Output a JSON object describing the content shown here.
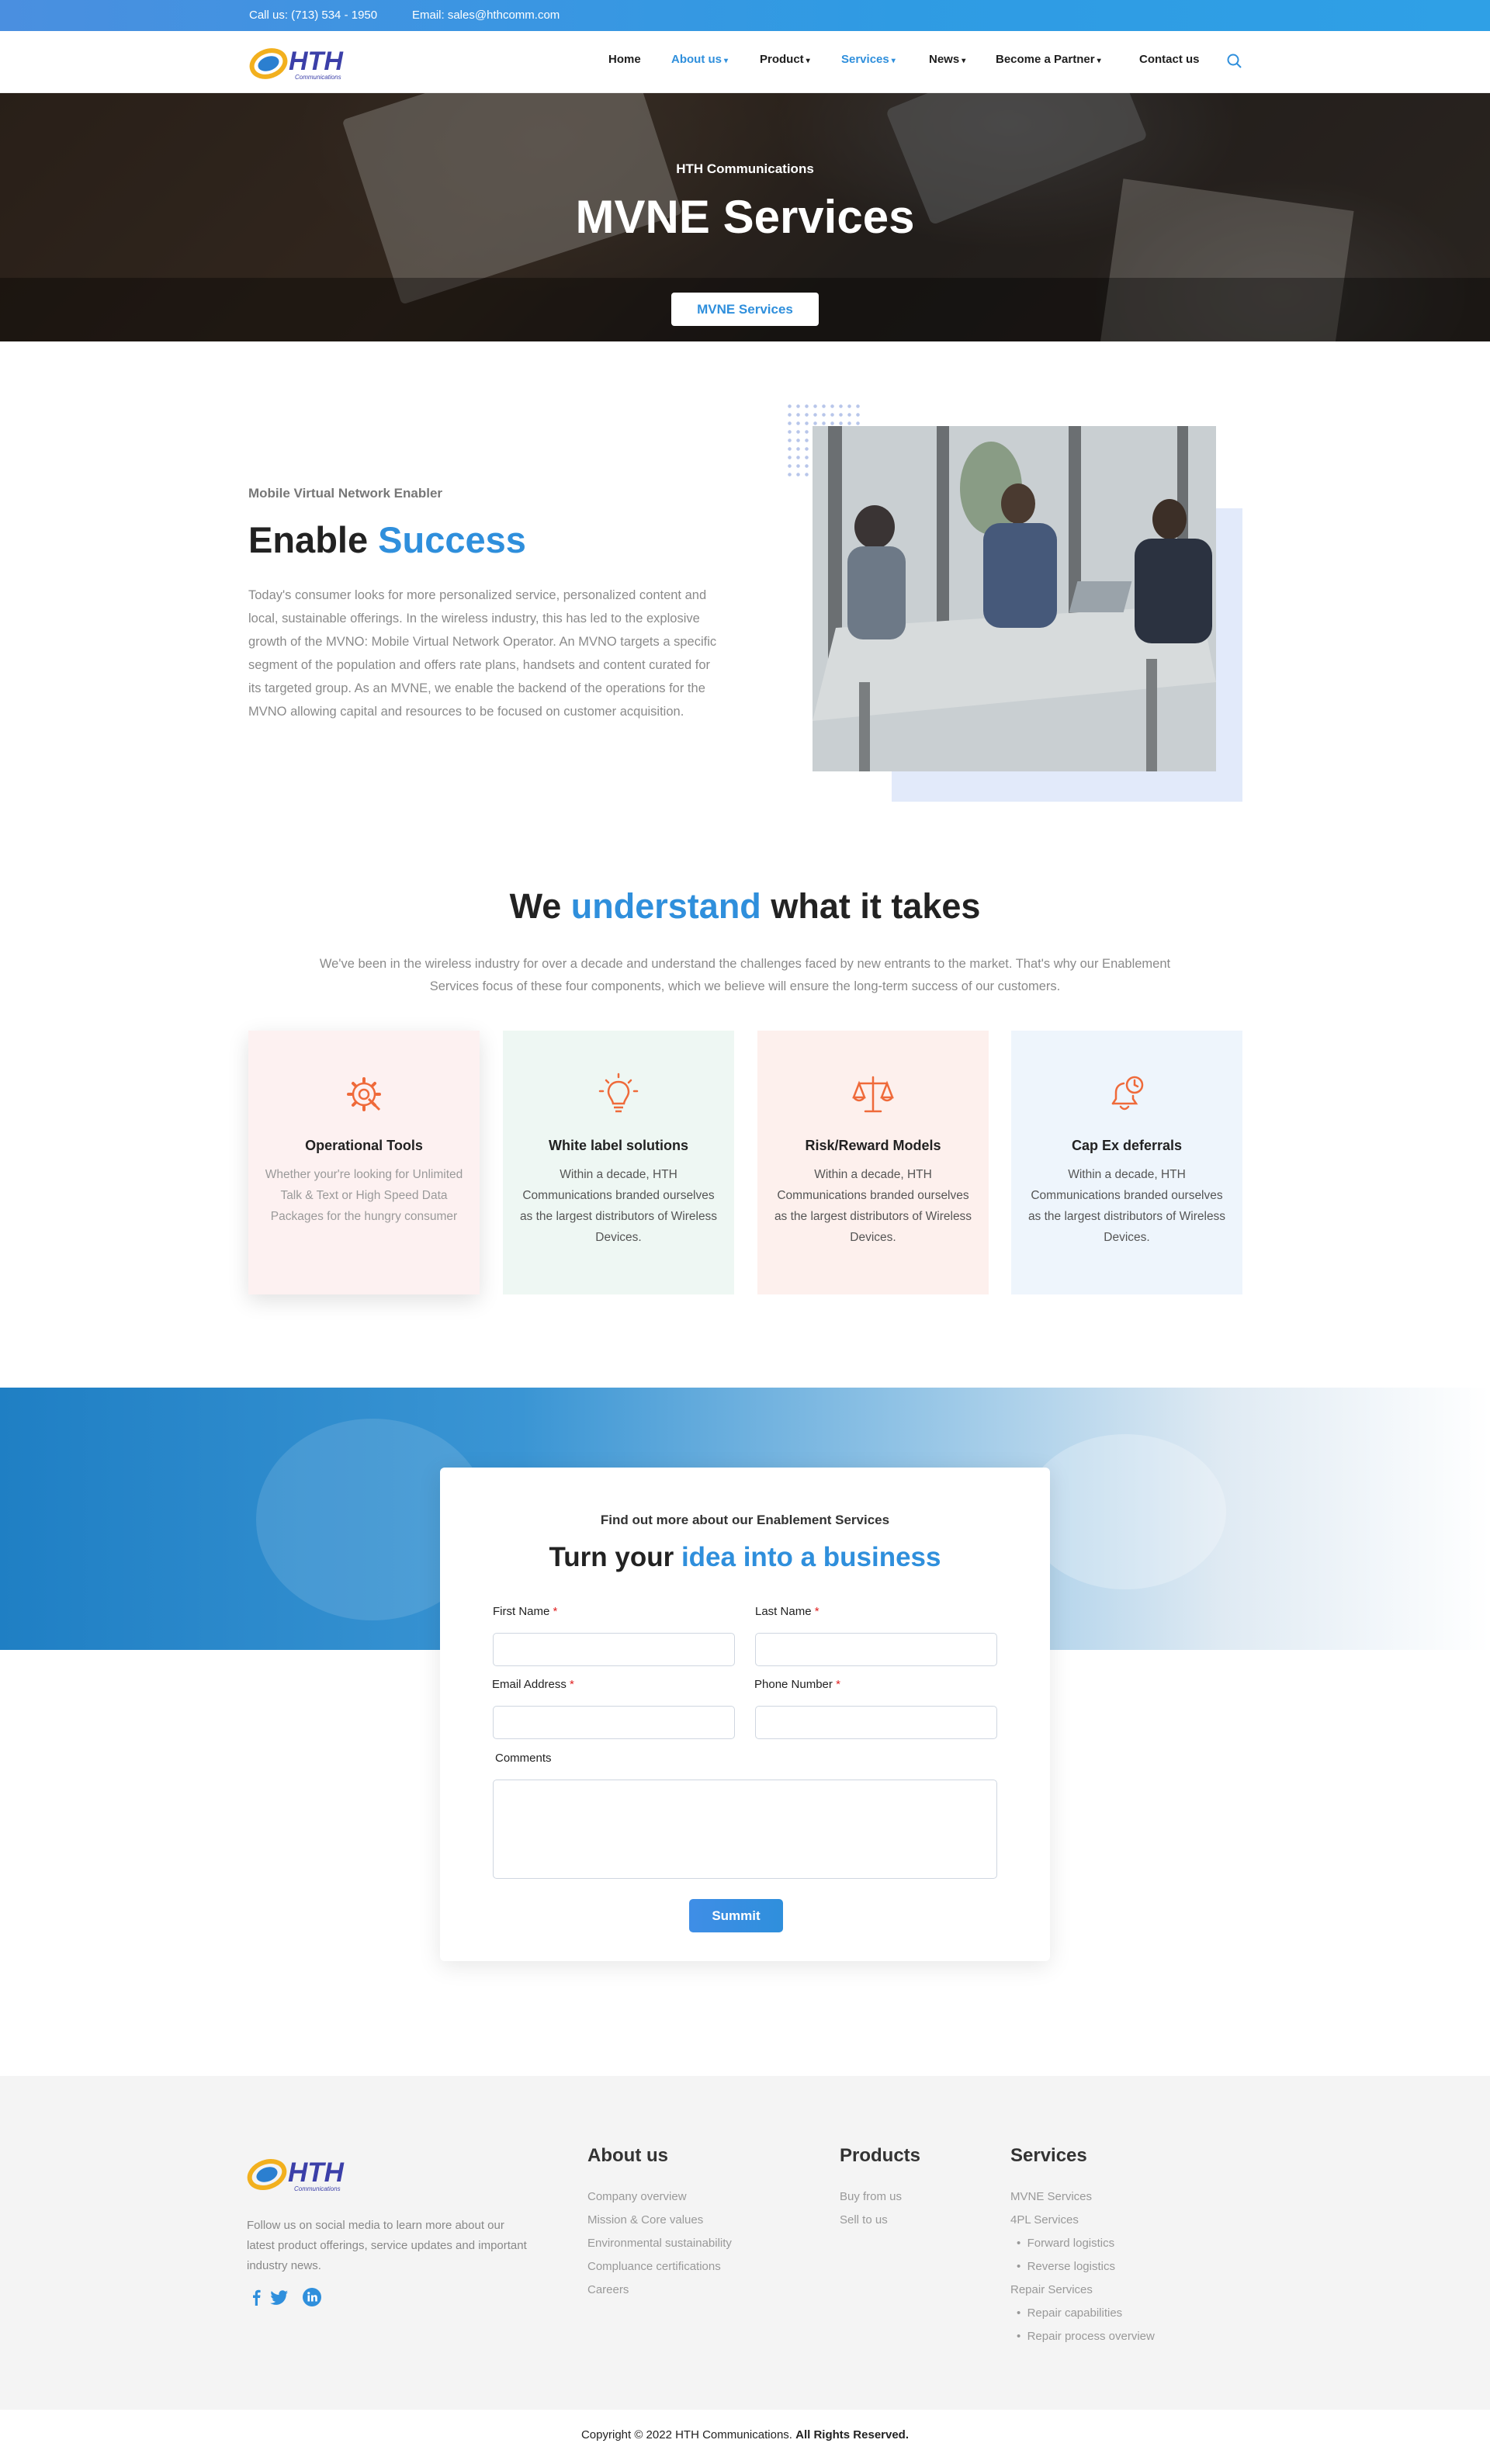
{
  "topbar": {
    "phone": "Call us: (713) 534 - 1950",
    "email": "Email: sales@hthcomm.com"
  },
  "brand": {
    "name": "HTH",
    "tagline": "Communications",
    "accent": "#2f8fdc"
  },
  "nav": {
    "items": [
      {
        "label": "Home"
      },
      {
        "label": "About us"
      },
      {
        "label": "Product"
      },
      {
        "label": "Services"
      },
      {
        "label": "News"
      },
      {
        "label": "Become a Partner"
      },
      {
        "label": "Contact us"
      }
    ],
    "caret": "▾"
  },
  "hero": {
    "subtitle": "HTH Communications",
    "title": "MVNE Services",
    "button": "MVNE Services"
  },
  "intro": {
    "eyebrow": "Mobile Virtual Network Enabler",
    "title_plain": "Enable",
    "title_accent": "Success",
    "body": "Today's consumer looks for more personalized service, personalized content and local, sustainable offerings. In the wireless industry, this has led to the explosive growth of the MVNO: Mobile Virtual Network Operator. An MVNO targets a specific segment of the population and offers rate plans, handsets and content curated for its targeted group. As an MVNE, we enable the backend of the operations for the MVNO allowing capital and resources to be focused on customer acquisition."
  },
  "understand": {
    "title_start": "We",
    "title_accent": "understand",
    "title_end": "what it takes",
    "body": "We've been in the wireless industry for over a decade and understand the challenges faced by new entrants to the market. That's why our Enablement Services focus of these four components, which we believe will ensure the long-term success of our customers.",
    "cards": [
      {
        "title": "Operational Tools",
        "text": "Whether your're looking for Unlimited Talk & Text or High Speed Data Packages for the hungry consumer",
        "icon": "gear-wrench-icon",
        "bg": "#fdf1f1"
      },
      {
        "title": "White label solutions",
        "text": "Within a decade, HTH Communications branded ourselves as the largest distributors of Wireless Devices.",
        "icon": "lightbulb-icon",
        "bg": "#eef7f3"
      },
      {
        "title": "Risk/Reward Models",
        "text": "Within a decade, HTH Communications branded ourselves as the largest distributors of Wireless Devices.",
        "icon": "balance-scale-icon",
        "bg": "#fdf0ed"
      },
      {
        "title": "Cap Ex deferrals",
        "text": "Within a decade, HTH Communications branded ourselves as the largest distributors of Wireless Devices.",
        "icon": "bell-clock-icon",
        "bg": "#eef5fc"
      }
    ]
  },
  "form": {
    "eyebrow": "Find out more about our Enablement Services",
    "title_plain": "Turn your",
    "title_accent": "idea into a business",
    "first_name": "First Name",
    "last_name": "Last Name",
    "email": "Email Address",
    "phone": "Phone Number",
    "comments": "Comments",
    "required_mark": "*",
    "submit": "Summit"
  },
  "footer": {
    "description": "Follow us on social media to learn more about our latest product offerings, service updates and important industry news.",
    "social": [
      "facebook-icon",
      "twitter-icon",
      "linkedin-icon"
    ],
    "about": {
      "heading": "About us",
      "links": [
        "Company overview",
        "Mission & Core values",
        "Environmental sustainability",
        "Compluance certifications",
        "Careers"
      ]
    },
    "products": {
      "heading": "Products",
      "links": [
        "Buy from us",
        "Sell to us"
      ]
    },
    "services": {
      "heading": "Services",
      "links": [
        "MVNE Services",
        "4PL Services",
        "Forward logistics",
        "Reverse logistics",
        "Repair Services",
        "Repair capabilities",
        "Repair process overview"
      ]
    },
    "copyright_plain": "Copyright © 2022 HTH Communications.",
    "copyright_bold": "All Rights Reserved."
  }
}
